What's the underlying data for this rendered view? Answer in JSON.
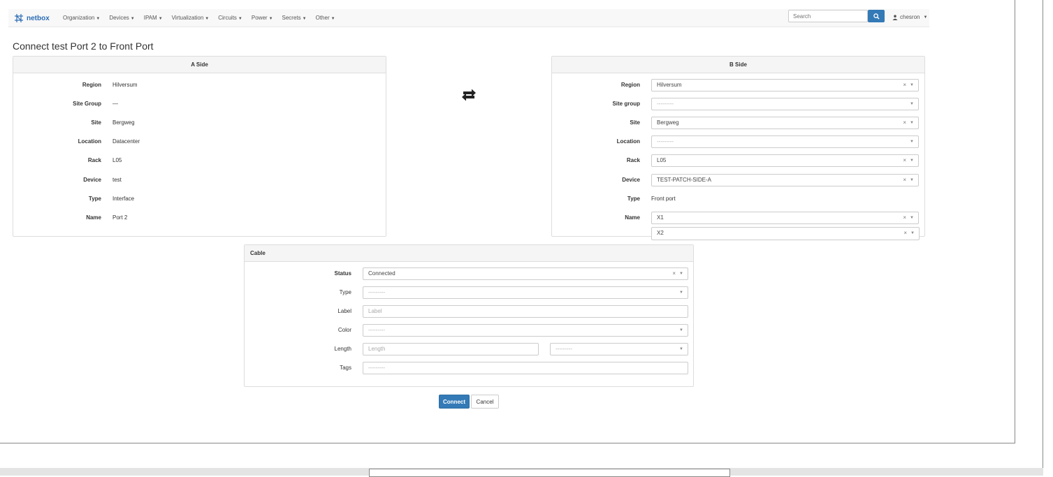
{
  "navbar": {
    "brand": "netbox",
    "items": [
      "Organization",
      "Devices",
      "IPAM",
      "Virtualization",
      "Circuits",
      "Power",
      "Secrets",
      "Other"
    ],
    "search_placeholder": "Search",
    "user": "chesron"
  },
  "page": {
    "title": "Connect test Port 2 to Front Port"
  },
  "a_side": {
    "header": "A Side",
    "fields": [
      {
        "label": "Region",
        "value": "Hilversum"
      },
      {
        "label": "Site Group",
        "value": "—"
      },
      {
        "label": "Site",
        "value": "Bergweg"
      },
      {
        "label": "Location",
        "value": "Datacenter"
      },
      {
        "label": "Rack",
        "value": "L05"
      },
      {
        "label": "Device",
        "value": "test"
      },
      {
        "label": "Type",
        "value": "Interface"
      },
      {
        "label": "Name",
        "value": "Port 2"
      }
    ]
  },
  "b_side": {
    "header": "B Side",
    "fields": [
      {
        "label": "Region",
        "value": "Hilversum"
      },
      {
        "label": "Site group",
        "value": "---------"
      },
      {
        "label": "Site",
        "value": "Bergweg"
      },
      {
        "label": "Location",
        "value": "---------"
      },
      {
        "label": "Rack",
        "value": "L05"
      },
      {
        "label": "Device",
        "value": "TEST-PATCH-SIDE-A"
      },
      {
        "label": "Type",
        "value": "Front port"
      },
      {
        "label": "Name",
        "value": "X1"
      }
    ],
    "name_extra": "X2",
    "clear_glyph": "×"
  },
  "cable": {
    "header": "Cable",
    "status": {
      "label": "Status",
      "value": "Connected"
    },
    "type": {
      "label": "Type",
      "value": "---------"
    },
    "label": {
      "label": "Label",
      "placeholder": "Label"
    },
    "color": {
      "label": "Color",
      "value": "---------"
    },
    "length": {
      "label": "Length",
      "placeholder": "Length",
      "unit": "---------"
    },
    "tags": {
      "label": "Tags",
      "value": "---------"
    }
  },
  "buttons": {
    "connect": "Connect",
    "cancel": "Cancel"
  },
  "colors": {
    "primary": "#337ab7",
    "brand": "#2b6cb5"
  }
}
